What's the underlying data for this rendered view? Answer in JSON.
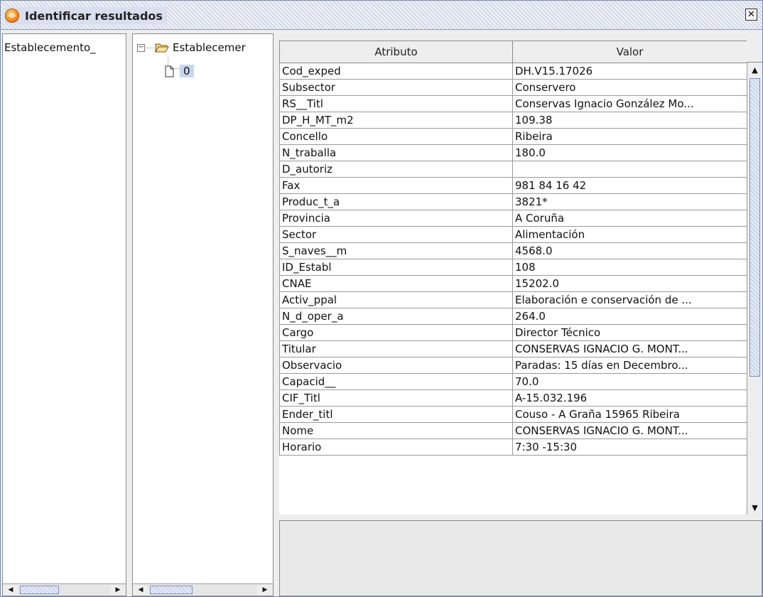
{
  "window": {
    "title": "Identificar resultados",
    "close_glyph": "✕",
    "icon": "gvsig-app-icon"
  },
  "layers_list": {
    "items": [
      "Establecemento_"
    ]
  },
  "tree": {
    "root_label": "Establecemer",
    "root_expander": "−",
    "root_icon": "open-folder-icon",
    "child_label": "0",
    "child_icon": "file-icon"
  },
  "table": {
    "headers": {
      "attribute": "Atributo",
      "value": "Valor"
    },
    "rows": [
      {
        "attr": "Cod_exped",
        "val": "DH.V15.17026"
      },
      {
        "attr": "Subsector",
        "val": "Conservero"
      },
      {
        "attr": "RS__Titl",
        "val": "Conservas Ignacio González Mo..."
      },
      {
        "attr": "DP_H_MT_m2",
        "val": "109.38"
      },
      {
        "attr": "Concello",
        "val": "Ribeira"
      },
      {
        "attr": "N_traballa",
        "val": "180.0"
      },
      {
        "attr": "D_autoriz",
        "val": ""
      },
      {
        "attr": "Fax",
        "val": "981 84 16 42"
      },
      {
        "attr": "Produc_t_a",
        "val": "3821*"
      },
      {
        "attr": "Provincia",
        "val": "A Coruña"
      },
      {
        "attr": "Sector",
        "val": "Alimentación"
      },
      {
        "attr": "S_naves__m",
        "val": "4568.0"
      },
      {
        "attr": "ID_Establ",
        "val": "108"
      },
      {
        "attr": "CNAE",
        "val": "15202.0"
      },
      {
        "attr": "Activ_ppal",
        "val": "Elaboración e conservación de ..."
      },
      {
        "attr": "N_d_oper_a",
        "val": "264.0"
      },
      {
        "attr": "Cargo",
        "val": "Director Técnico"
      },
      {
        "attr": "Titular",
        "val": "CONSERVAS IGNACIO G. MONT..."
      },
      {
        "attr": "Observacio",
        "val": "Paradas: 15 días en Decembro..."
      },
      {
        "attr": "Capacid__",
        "val": "70.0"
      },
      {
        "attr": "CIF_Titl",
        "val": "A-15.032.196"
      },
      {
        "attr": "Ender_titl",
        "val": "Couso - A Graña 15965 Ribeira"
      },
      {
        "attr": "Nome",
        "val": "CONSERVAS IGNACIO G. MONT..."
      },
      {
        "attr": "Horario",
        "val": "7:30 -15:30"
      }
    ]
  },
  "scrollbars": {
    "left_arrow": "◀",
    "right_arrow": "▶",
    "up_arrow": "▲",
    "down_arrow": "▼"
  },
  "colors": {
    "selection": "#c7d6ec",
    "scroll_thumb": "#c9d4ec",
    "titlebar": "#e4e8f2"
  }
}
